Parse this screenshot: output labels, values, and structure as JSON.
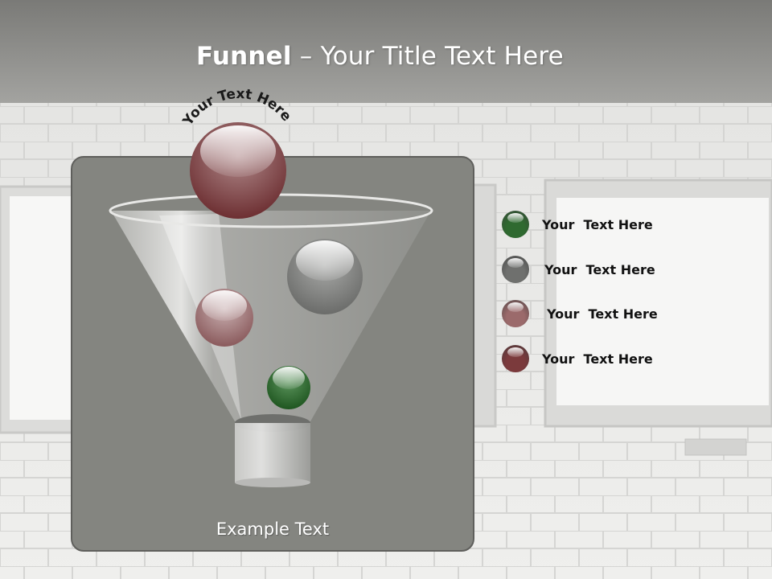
{
  "title": {
    "bold": "Funnel",
    "dash": "–",
    "rest": "Your Title Text Here"
  },
  "funnel": {
    "arc_label": "Your Text Here",
    "bottom_label": "Example Text",
    "ball_colors": [
      "#7b3a3c",
      "#7a7b7a",
      "#7b3a3c",
      "#2f6a30"
    ]
  },
  "legend": [
    {
      "label": "Your  Text Here",
      "color": "#2f6a30"
    },
    {
      "label": "Your  Text Here",
      "color": "#6f706e"
    },
    {
      "label": "Your  Text Here",
      "color": "#9b6a6b"
    },
    {
      "label": "Your  Text Here",
      "color": "#7b3a3c"
    }
  ]
}
